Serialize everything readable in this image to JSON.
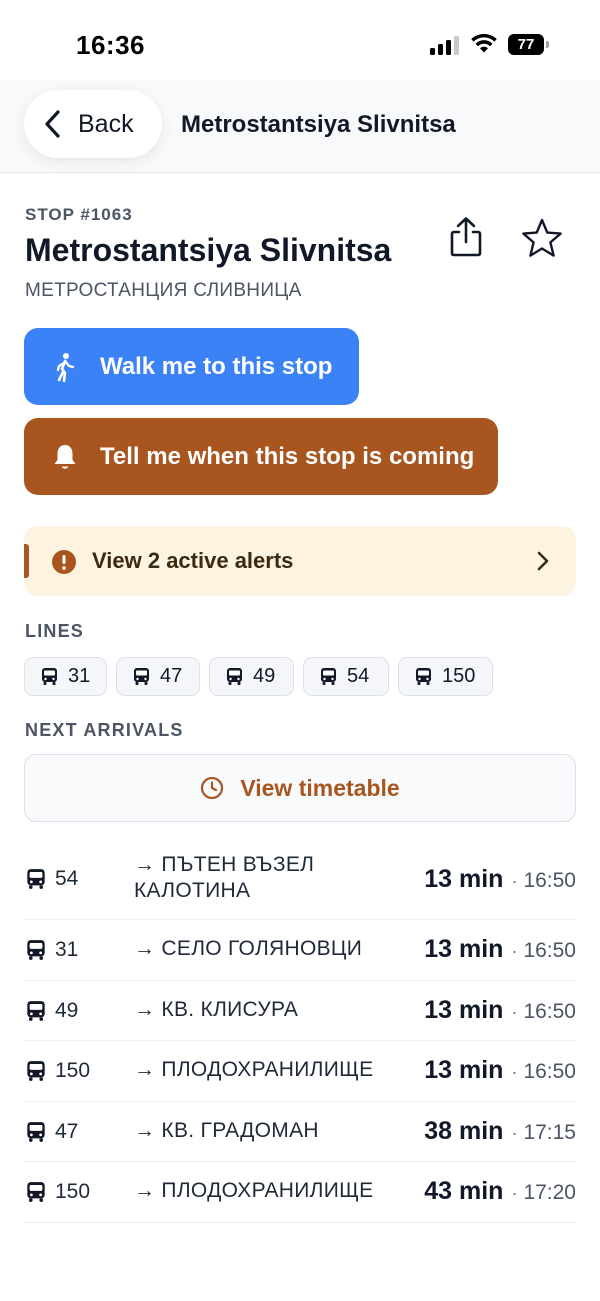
{
  "status_bar": {
    "time": "16:36",
    "battery": "77"
  },
  "header": {
    "back_label": "Back",
    "title": "Metrostantsiya Slivnitsa"
  },
  "stop": {
    "code": "STOP #1063",
    "name": "Metrostantsiya Slivnitsa",
    "name_local": "МЕТРОСТАНЦИЯ СЛИВНИЦА"
  },
  "actions": {
    "walk_label": "Walk me to this stop",
    "notify_label": "Tell me when this stop is coming"
  },
  "alerts": {
    "label": "View 2 active alerts"
  },
  "lines": {
    "label": "LINES",
    "items": [
      "31",
      "47",
      "49",
      "54",
      "150"
    ]
  },
  "arrivals": {
    "label": "NEXT ARRIVALS",
    "timetable_label": "View timetable",
    "rows": [
      {
        "line": "54",
        "dest_1": "→ ПЪТЕН ВЪЗЕЛ",
        "dest_2": "КАЛОТИНА",
        "eta": "13 min",
        "sep": "·",
        "clock": "16:50"
      },
      {
        "line": "31",
        "dest_1": "→ СЕЛО ГОЛЯНОВЦИ",
        "dest_2": "",
        "eta": "13 min",
        "sep": "·",
        "clock": "16:50"
      },
      {
        "line": "49",
        "dest_1": "→ КВ. КЛИСУРА",
        "dest_2": "",
        "eta": "13 min",
        "sep": "·",
        "clock": "16:50"
      },
      {
        "line": "150",
        "dest_1": "→ ПЛОДОХРАНИЛИЩЕ",
        "dest_2": "",
        "eta": "13 min",
        "sep": "·",
        "clock": "16:50"
      },
      {
        "line": "47",
        "dest_1": "→ КВ. ГРАДОМАН",
        "dest_2": "",
        "eta": "38 min",
        "sep": "·",
        "clock": "17:15"
      },
      {
        "line": "150",
        "dest_1": "→ ПЛОДОХРАНИЛИЩЕ",
        "dest_2": "",
        "eta": "43 min",
        "sep": "·",
        "clock": "17:20"
      }
    ]
  },
  "colors": {
    "primary_blue": "#3b82f6",
    "accent_brown": "#a85520",
    "alert_bg": "#fdf3e1"
  }
}
